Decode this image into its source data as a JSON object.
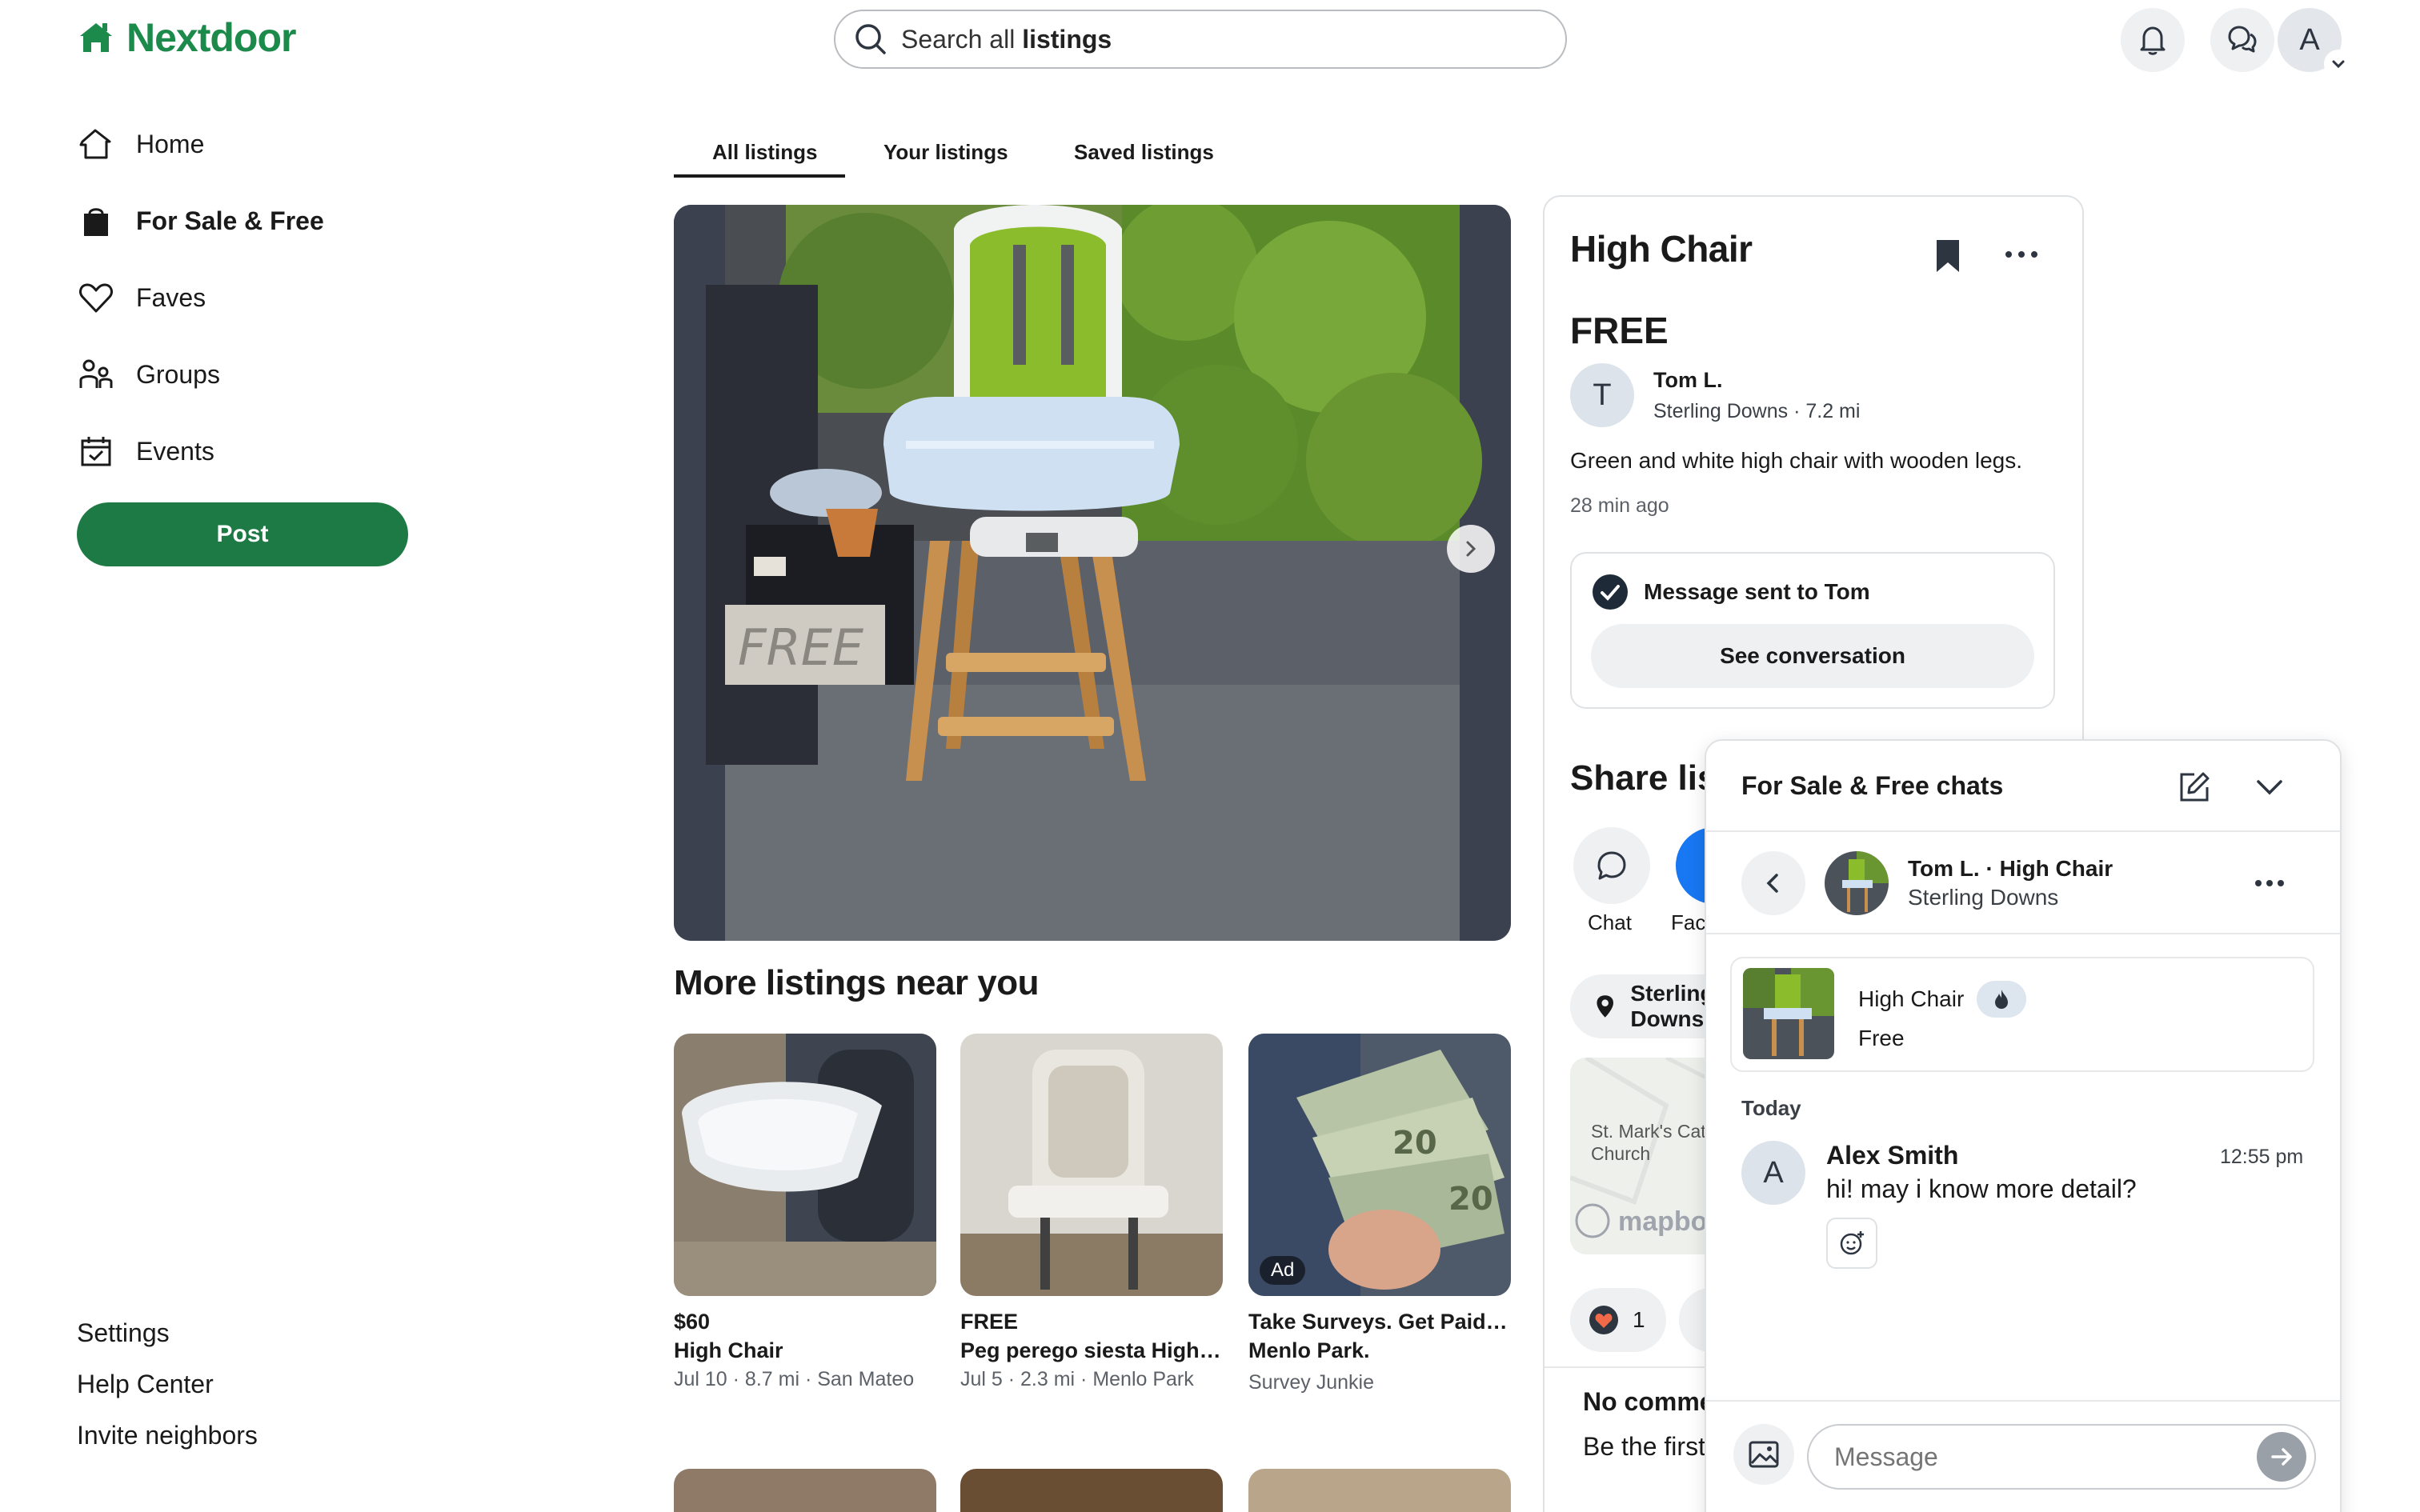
{
  "app": {
    "name": "Nextdoor",
    "brand_color": "#1b8a4b",
    "post_color": "#1e7a44"
  },
  "search": {
    "prefix": "Search all ",
    "bold": "listings"
  },
  "header": {
    "avatar_initial": "A"
  },
  "sidebar": {
    "items": [
      {
        "label": "Home",
        "icon": "home-icon"
      },
      {
        "label": "For Sale & Free",
        "icon": "shopping-bag-icon",
        "active": true
      },
      {
        "label": "Faves",
        "icon": "heart-icon"
      },
      {
        "label": "Groups",
        "icon": "groups-icon"
      },
      {
        "label": "Events",
        "icon": "calendar-icon"
      }
    ],
    "post_label": "Post",
    "footer": [
      "Settings",
      "Help Center",
      "Invite neighbors"
    ]
  },
  "tabs": [
    "All listings",
    "Your listings",
    "Saved listings"
  ],
  "more": {
    "title": "More listings near you",
    "cards": [
      {
        "line1": "$60",
        "line2": "High Chair",
        "meta": "Jul 10 · 8.7 mi · San Mateo"
      },
      {
        "line1": "FREE",
        "line2": "Peg perego siesta High Chair",
        "meta": "Jul 5 · 2.3 mi · Menlo Park"
      },
      {
        "line1": "Take Surveys. Get Paid in",
        "line2": "Menlo Park.",
        "meta": "Survey Junkie",
        "badge": "Ad"
      }
    ]
  },
  "detail": {
    "title": "High Chair",
    "price": "FREE",
    "seller_initial": "T",
    "seller": "Tom L.",
    "seller_loc": "Sterling Downs · 7.2 mi",
    "description": "Green and white high chair with wooden legs.",
    "posted": "28 min ago",
    "message_sent": "Message sent to Tom",
    "see_conversation": "See conversation",
    "share_title": "Share listing",
    "share_buttons": [
      "Chat",
      "Facebook"
    ],
    "location_pill": "Sterling Downs",
    "map_label": "St. Mark's Catholic Church",
    "map_logo": "mapbox",
    "reaction_count": "1",
    "no_comments": "No comments yet",
    "be_first": "Be the first to comment"
  },
  "chat": {
    "title": "For Sale & Free chats",
    "conv_name": "Tom L. · High Chair",
    "conv_loc": "Sterling Downs",
    "listing_title": "High Chair",
    "listing_price": "Free",
    "day": "Today",
    "msg_initial": "A",
    "msg_name": "Alex Smith",
    "msg_time": "12:55 pm",
    "msg_text": "hi! may i know more detail?",
    "input_placeholder": "Message"
  }
}
